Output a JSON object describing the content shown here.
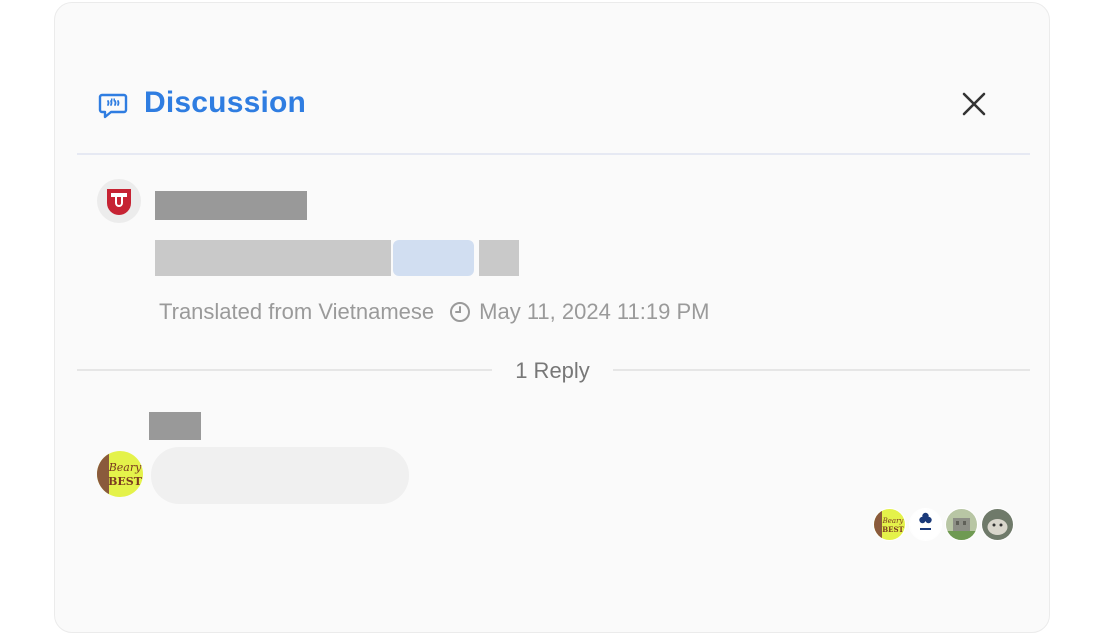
{
  "header": {
    "title": "Discussion",
    "icon": "chat-bubble-icon",
    "close_icon": "close-icon",
    "accent_color": "#2f7de1"
  },
  "comment": {
    "avatar_icon": "brand-logo-icon",
    "meta_translated": "Translated from Vietnamese",
    "meta_time_icon": "clock-icon",
    "meta_timestamp": "May 11, 2024 11:19 PM"
  },
  "replies": {
    "count_label": "1 Reply",
    "reply_avatar_icon": "bear-avatar-icon"
  },
  "reactors": {
    "icons": [
      "bear-avatar-icon",
      "org-logo-icon",
      "building-photo-icon",
      "animal-photo-icon"
    ]
  }
}
